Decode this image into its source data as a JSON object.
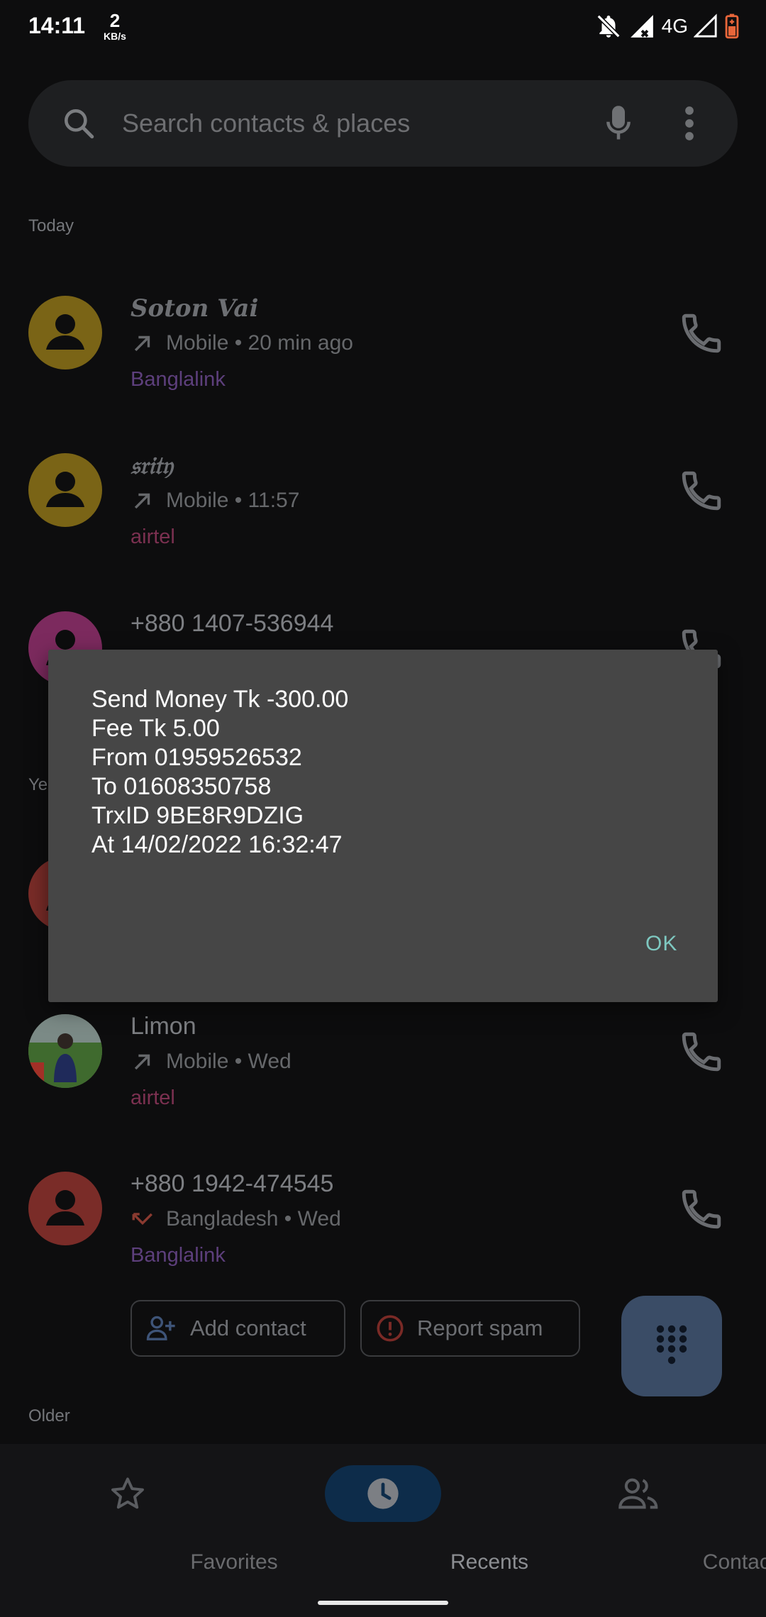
{
  "status_bar": {
    "time": "14:11",
    "speed_value": "2",
    "speed_unit": "KB/s",
    "network": "4G"
  },
  "search": {
    "placeholder": "Search contacts & places"
  },
  "sections": {
    "today": "Today",
    "yesterday_partial": "Ye",
    "older": "Older"
  },
  "calls": [
    {
      "name": "Soton Vai",
      "direction": "outgoing",
      "meta": "Mobile • 20 min ago",
      "sim": "Banglalink",
      "avatar_color": "#7a6416"
    },
    {
      "name": "𝔰𝔯𝔦𝔱𝔶",
      "direction": "outgoing",
      "meta": "Mobile • 11:57",
      "sim": "airtel",
      "avatar_color": "#7a6416"
    },
    {
      "name": "+880 1407-536944",
      "avatar_color": "#7c2a5e"
    },
    {
      "avatar_color": "#7a2c28"
    },
    {
      "name": "Limon",
      "direction": "outgoing",
      "meta": "Mobile • Wed",
      "sim": "airtel",
      "avatar": "photo"
    },
    {
      "name": "+880 1942-474545",
      "direction": "missed",
      "meta": "Bangladesh • Wed",
      "sim": "Banglalink",
      "avatar_color": "#7a2c28"
    }
  ],
  "chips": {
    "add_contact": "Add contact",
    "report_spam": "Report spam"
  },
  "nav": {
    "favorites": "Favorites",
    "recents": "Recents",
    "contacts": "Contacts",
    "active": "recents"
  },
  "dialog": {
    "lines": [
      "Send Money Tk -300.00",
      "Fee Tk 5.00",
      "From 01959526532",
      "To 01608350758",
      "TrxID 9BE8R9DZIG",
      "At 14/02/2022 16:32:47"
    ],
    "ok_label": "OK"
  },
  "colors": {
    "scrim": "#0d0d0e",
    "dialog_bg": "#464646",
    "ok_accent": "#7ec8c0",
    "fab_bg": "#3a4c66"
  }
}
